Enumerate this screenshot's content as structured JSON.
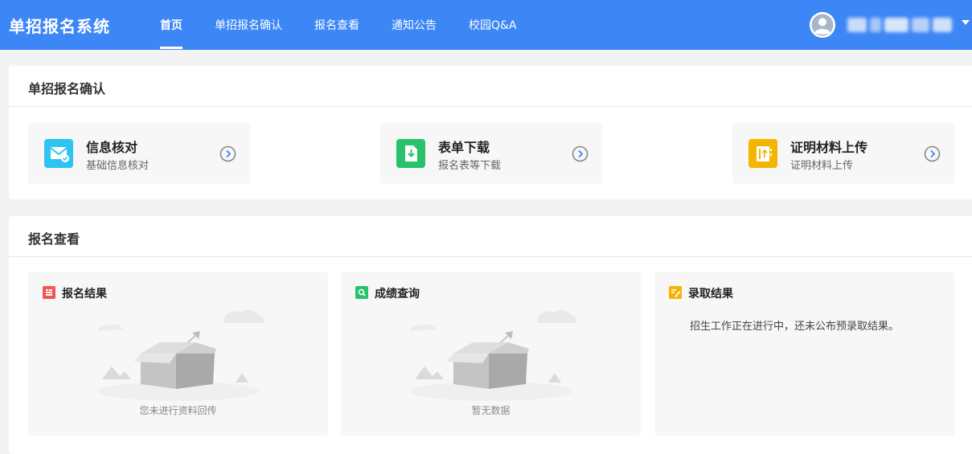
{
  "header": {
    "app_title": "单招报名系统",
    "nav": [
      {
        "label": "首页",
        "active": true
      },
      {
        "label": "单招报名确认"
      },
      {
        "label": "报名查看"
      },
      {
        "label": "通知公告"
      },
      {
        "label": "校园Q&A"
      }
    ],
    "user_icon": "avatar-icon",
    "caret_icon": "caret-down-icon"
  },
  "confirm_section": {
    "title": "单招报名确认",
    "cards": [
      {
        "title": "信息核对",
        "subtitle": "基础信息核对",
        "icon": "mail-check-icon",
        "color": "#2ec4f1"
      },
      {
        "title": "表单下载",
        "subtitle": "报名表等下载",
        "icon": "file-download-icon",
        "color": "#27c26b"
      },
      {
        "title": "证明材料上传",
        "subtitle": "证明材料上传",
        "icon": "document-upload-icon",
        "color": "#f4b400"
      }
    ],
    "arrow_icon": "chevron-right-circle-icon"
  },
  "view_section": {
    "title": "报名查看",
    "cards": [
      {
        "title": "报名结果",
        "icon": "list-icon",
        "color": "#f05656",
        "empty_text": "您未进行资料回传"
      },
      {
        "title": "成绩查询",
        "icon": "search-doc-icon",
        "color": "#27c26b",
        "empty_text": "暂无数据"
      },
      {
        "title": "录取结果",
        "icon": "edit-doc-icon",
        "color": "#f4b400",
        "message": "招生工作正在进行中，还未公布预录取结果。"
      }
    ]
  },
  "colors": {
    "primary": "#3d86f5",
    "card_bg": "#f7f7f7",
    "page_bg": "#f3f3f3"
  }
}
